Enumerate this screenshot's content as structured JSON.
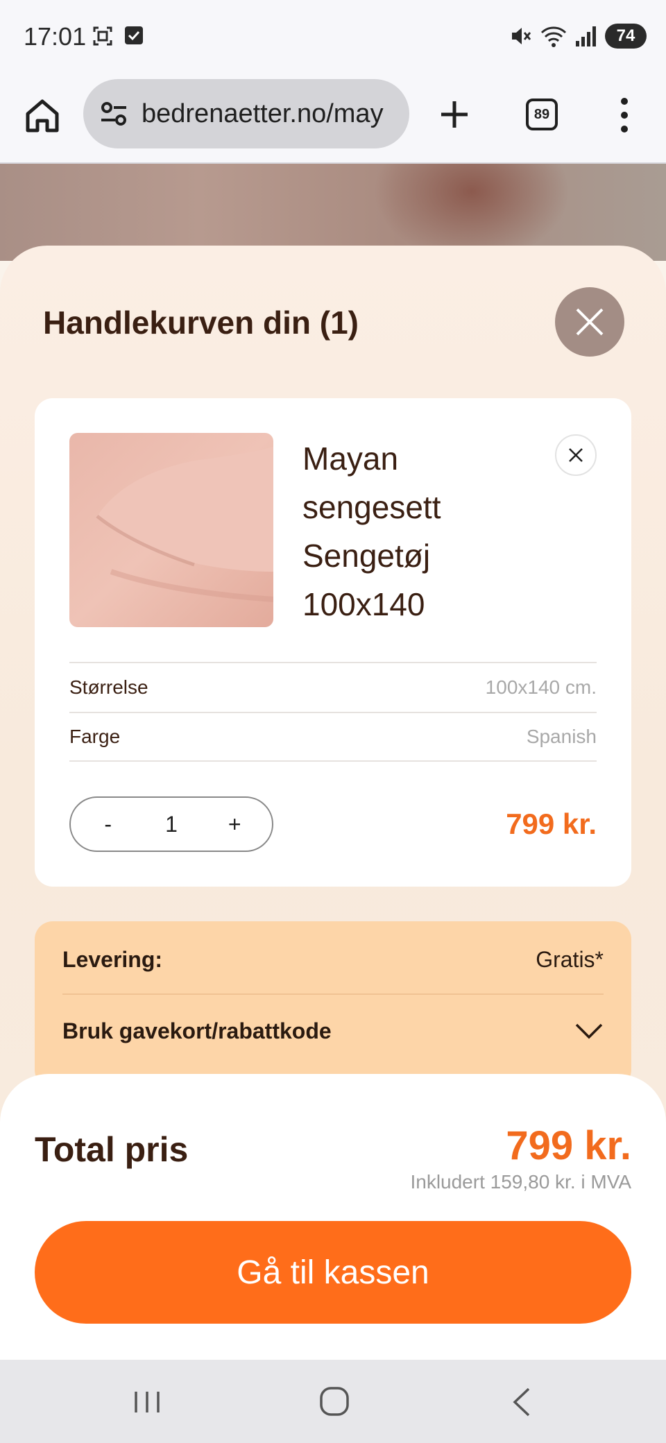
{
  "status_bar": {
    "time": "17:01",
    "battery": "74",
    "icons": [
      "screenshot-icon",
      "checkbox-icon",
      "mute-icon",
      "wifi-icon",
      "signal-icon"
    ]
  },
  "browser": {
    "url": "bedrenaetter.no/may",
    "tab_count": "89"
  },
  "cart": {
    "title": "Handlekurven din (1)",
    "item": {
      "name_lines": [
        "Mayan",
        "sengesett",
        "Sengetøj",
        "100x140"
      ],
      "specs": [
        {
          "label": "Størrelse",
          "value": "100x140 cm."
        },
        {
          "label": "Farge",
          "value": "Spanish"
        }
      ],
      "qty_minus": "-",
      "qty": "1",
      "qty_plus": "+",
      "price": "799 kr."
    },
    "delivery": {
      "label": "Levering:",
      "value": "Gratis*",
      "giftcard_label": "Bruk gavekort/rabattkode"
    }
  },
  "summary": {
    "total_label": "Total pris",
    "total_price": "799 kr.",
    "vat_note": "Inkludert 159,80 kr. i MVA",
    "checkout_label": "Gå til kassen"
  },
  "colors": {
    "accent": "#ff6d1a",
    "price": "#f26b1d",
    "delivery_bg": "#fdd5a8",
    "drawer_bg": "#fbeee4"
  }
}
